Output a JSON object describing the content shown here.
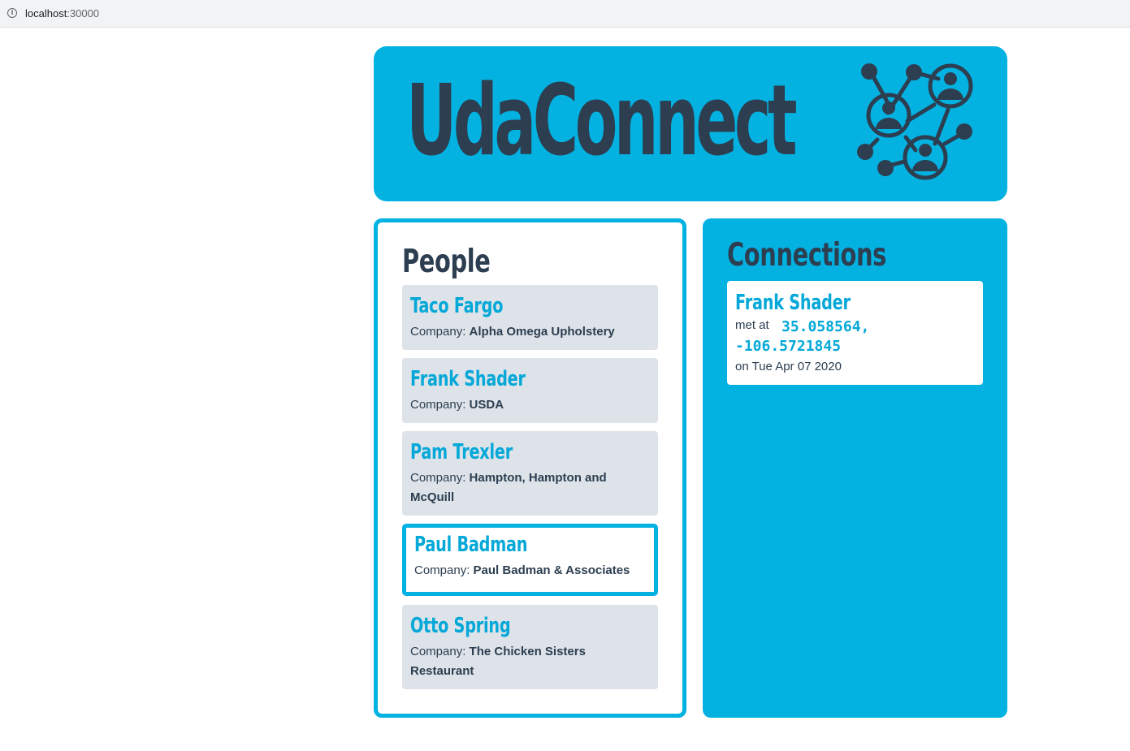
{
  "browser": {
    "url_host": "localhost",
    "url_port": ":30000"
  },
  "header": {
    "title": "UdaConnect",
    "logo_icon": "people-network-icon"
  },
  "people": {
    "title": "People",
    "company_label": "Company:",
    "items": [
      {
        "name": "Taco Fargo",
        "company": "Alpha Omega Upholstery",
        "selected": false
      },
      {
        "name": "Frank Shader",
        "company": "USDA",
        "selected": false
      },
      {
        "name": "Pam Trexler",
        "company": "Hampton, Hampton and McQuill",
        "selected": false
      },
      {
        "name": "Paul Badman",
        "company": "Paul Badman & Associates",
        "selected": true
      },
      {
        "name": "Otto Spring",
        "company": "The Chicken Sisters Restaurant",
        "selected": false
      }
    ]
  },
  "connections": {
    "title": "Connections",
    "items": [
      {
        "name": "Frank Shader",
        "met_at_label": "met at",
        "latitude": "35.058564,",
        "longitude": "-106.5721845",
        "date_text": "on Tue Apr 07 2020"
      }
    ]
  },
  "colors": {
    "accent": "#04b2e2",
    "text_dark": "#2c3e50",
    "card_gray": "#dde3e9"
  }
}
